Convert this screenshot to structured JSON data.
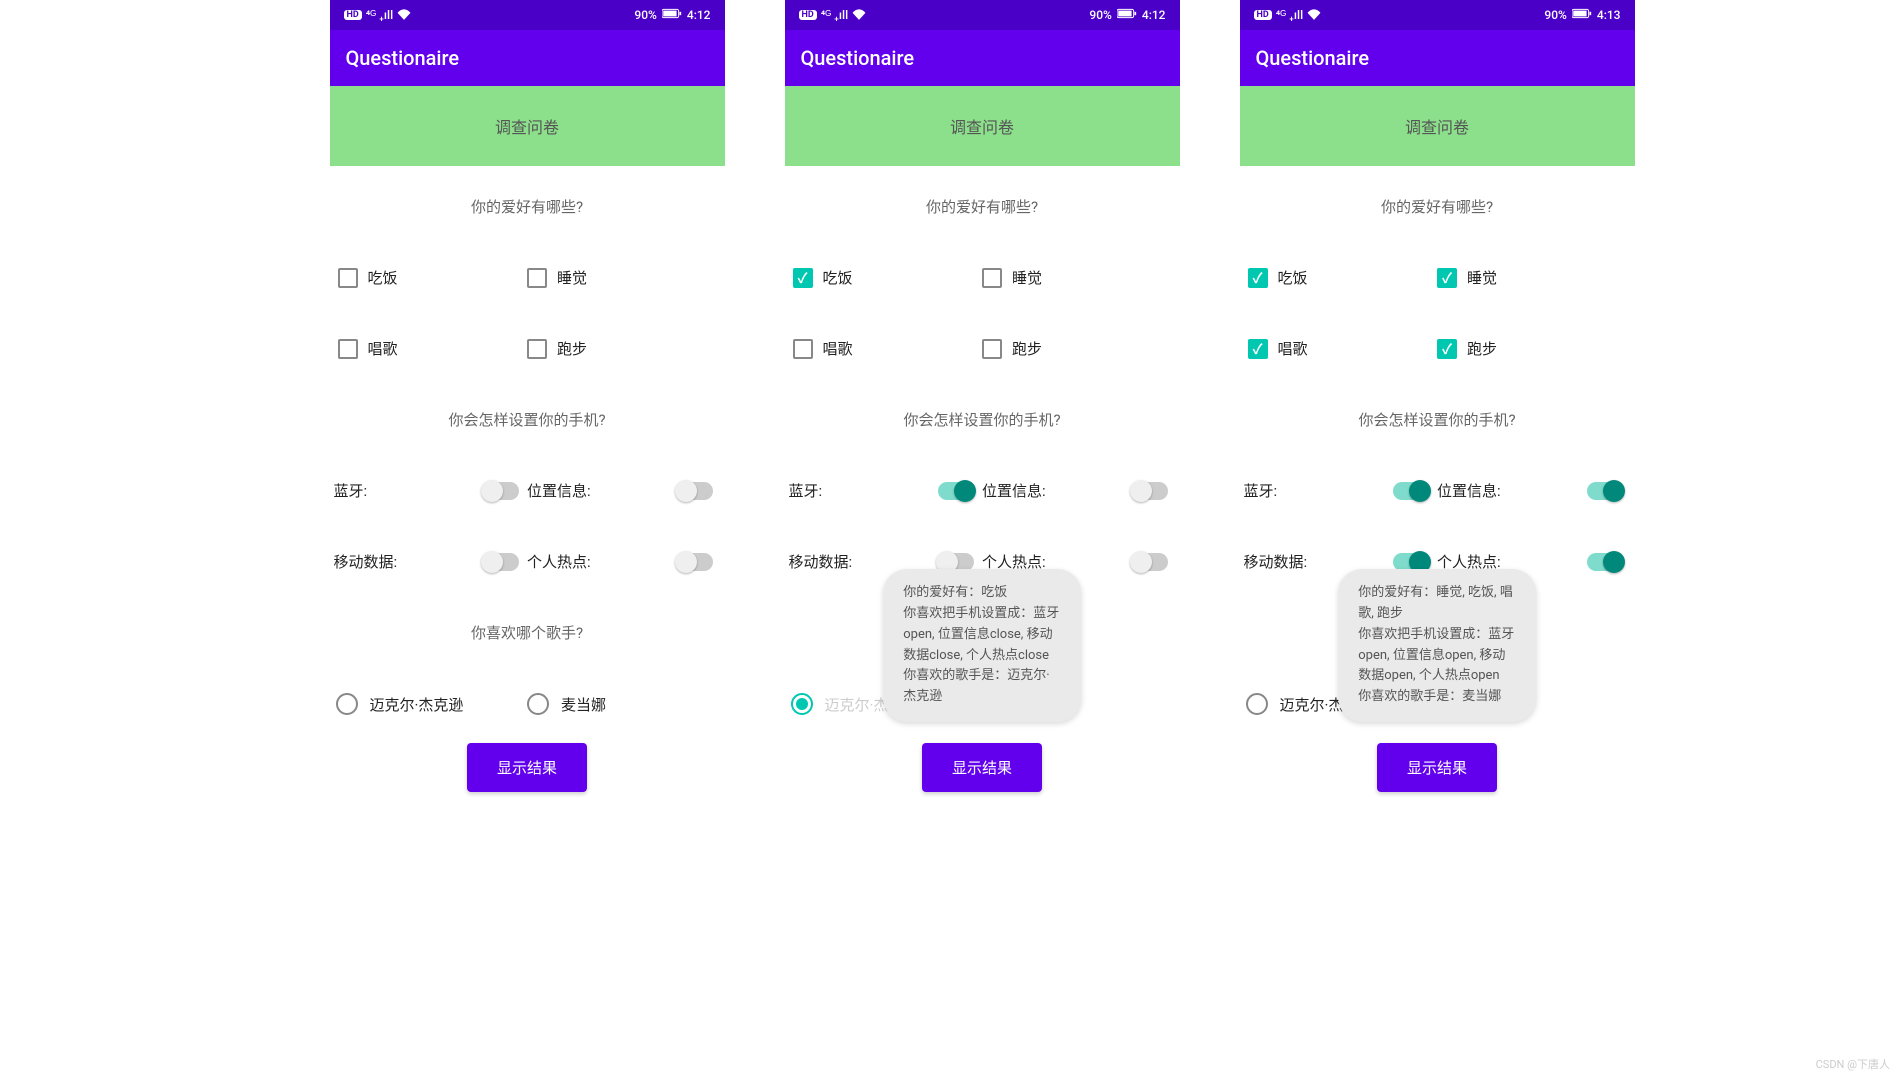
{
  "app_title": "Questionaire",
  "banner_text": "调查问卷",
  "q1": "你的爱好有哪些?",
  "q2": "你会怎样设置你的手机?",
  "q3": "你喜欢哪个歌手?",
  "button_label": "显示结果",
  "checkbox_labels": [
    "吃饭",
    "睡觉",
    "唱歌",
    "跑步"
  ],
  "switch_labels": [
    "蓝牙:",
    "位置信息:",
    "移动数据:",
    "个人热点:"
  ],
  "radio_labels": [
    "迈克尔·杰克逊",
    "麦当娜"
  ],
  "watermark": "CSDN @下唐人",
  "screens": [
    {
      "time": "4:12",
      "battery": "90%",
      "checks": [
        false,
        false,
        false,
        false
      ],
      "switches": [
        false,
        false,
        false,
        false
      ],
      "radio": null,
      "toast": null
    },
    {
      "time": "4:12",
      "battery": "90%",
      "checks": [
        true,
        false,
        false,
        false
      ],
      "switches": [
        true,
        false,
        false,
        false
      ],
      "radio": 0,
      "toast": "你的爱好有：吃饭\n你喜欢把手机设置成：蓝牙open, 位置信息close, 移动数据close, 个人热点close\n你喜欢的歌手是：迈克尔·杰克逊"
    },
    {
      "time": "4:13",
      "battery": "90%",
      "checks": [
        true,
        true,
        true,
        true
      ],
      "switches": [
        true,
        true,
        true,
        true
      ],
      "radio": 1,
      "toast": "你的爱好有：睡觉, 吃饭, 唱歌, 跑步\n你喜欢把手机设置成：蓝牙open, 位置信息open, 移动数据open, 个人热点open\n你喜欢的歌手是：麦当娜"
    }
  ]
}
